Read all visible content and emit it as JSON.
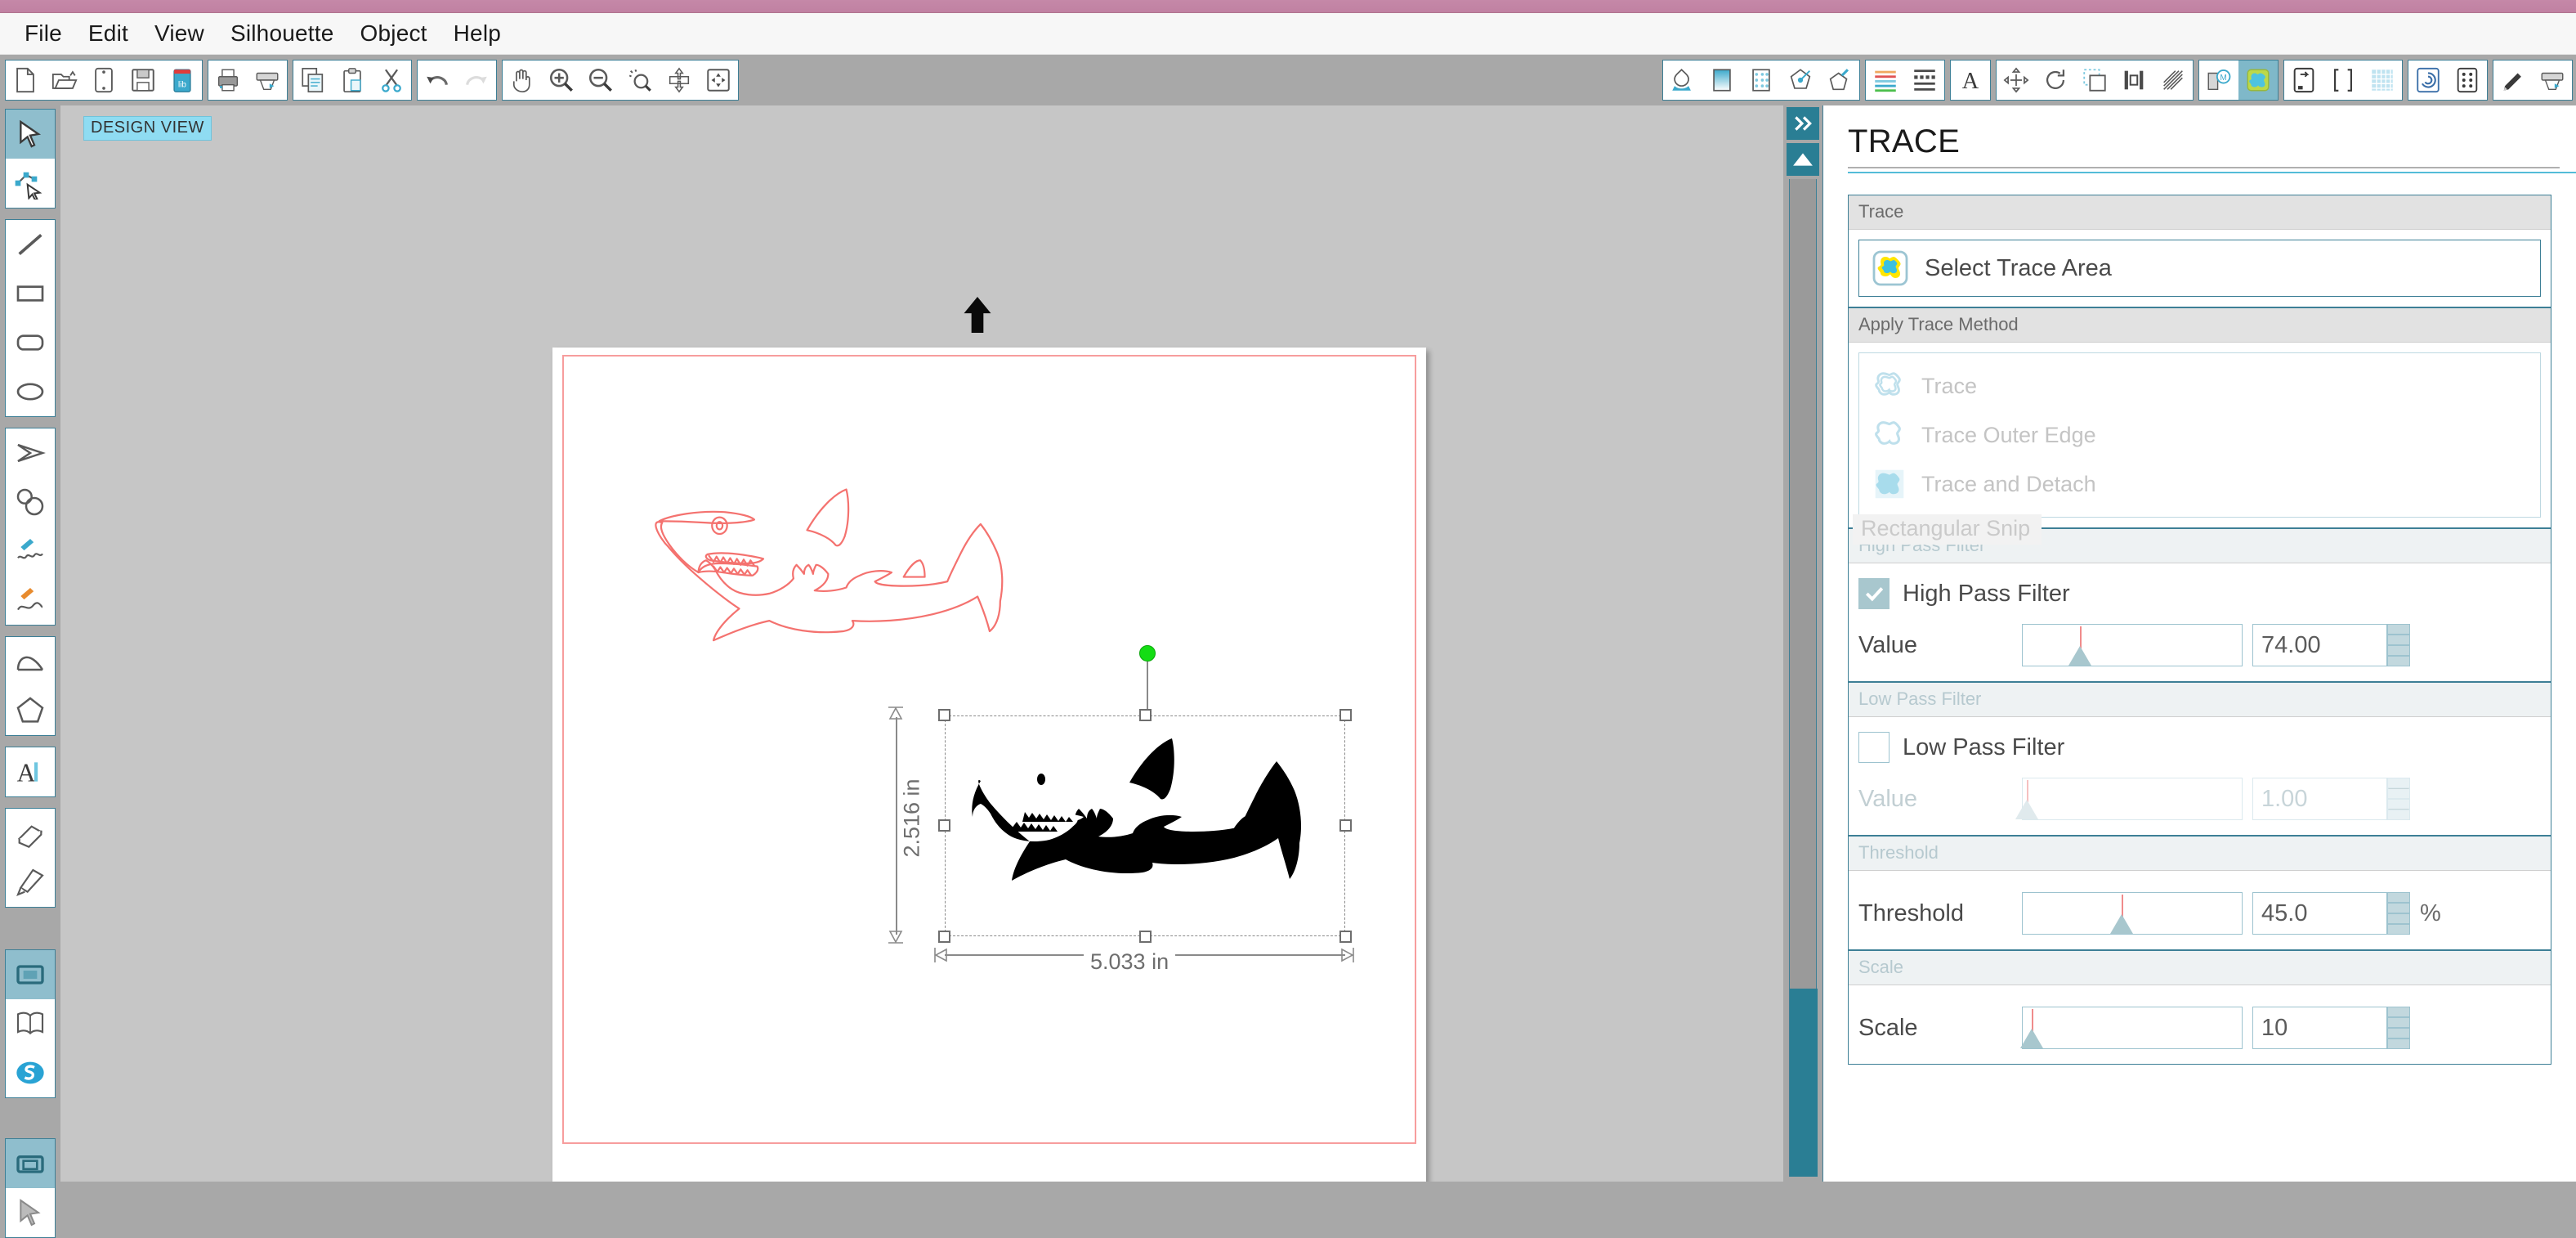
{
  "window": {
    "title_bar_color": "#c588a8"
  },
  "menubar": {
    "items": [
      {
        "label": "File"
      },
      {
        "label": "Edit"
      },
      {
        "label": "View"
      },
      {
        "label": "Silhouette"
      },
      {
        "label": "Object"
      },
      {
        "label": "Help"
      }
    ]
  },
  "toolbar": {
    "left_groups": [
      {
        "buttons": [
          {
            "name": "new-document-icon",
            "label": "New"
          },
          {
            "name": "open-document-icon",
            "label": "Open"
          },
          {
            "name": "save-as-icon",
            "label": "Save As"
          },
          {
            "name": "save-icon",
            "label": "Save"
          },
          {
            "name": "library-icon",
            "label": "Library"
          }
        ]
      },
      {
        "buttons": [
          {
            "name": "print-icon",
            "label": "Print"
          },
          {
            "name": "send-to-silhouette-icon",
            "label": "Send"
          }
        ]
      },
      {
        "buttons": [
          {
            "name": "copy-icon",
            "label": "Copy"
          },
          {
            "name": "paste-icon",
            "label": "Paste"
          },
          {
            "name": "cut-icon",
            "label": "Cut"
          }
        ]
      },
      {
        "buttons": [
          {
            "name": "undo-icon",
            "label": "Undo"
          },
          {
            "name": "redo-icon",
            "label": "Redo"
          }
        ]
      },
      {
        "buttons": [
          {
            "name": "pan-hand-icon",
            "label": "Pan"
          },
          {
            "name": "zoom-in-icon",
            "label": "Zoom In"
          },
          {
            "name": "zoom-out-icon",
            "label": "Zoom Out"
          },
          {
            "name": "zoom-selection-icon",
            "label": "Zoom to Selection"
          },
          {
            "name": "fit-to-page-icon",
            "label": "Fit to Page"
          },
          {
            "name": "fit-to-window-icon",
            "label": "Fit to Window"
          }
        ]
      }
    ],
    "right_groups": [
      {
        "buttons": [
          {
            "name": "fill-color-icon",
            "label": "Fill Color"
          },
          {
            "name": "gradient-fill-icon",
            "label": "Gradient Fill"
          },
          {
            "name": "pattern-fill-icon",
            "label": "Pattern Fill"
          },
          {
            "name": "line-color-icon",
            "label": "Line Color"
          },
          {
            "name": "sketch-pen-icon",
            "label": "Sketch Pen"
          }
        ]
      },
      {
        "buttons": [
          {
            "name": "line-style-icon",
            "label": "Line Style"
          },
          {
            "name": "stipple-icon",
            "label": "Stipple"
          }
        ]
      },
      {
        "buttons": [
          {
            "name": "text-style-icon",
            "label": "Text Style"
          }
        ]
      },
      {
        "buttons": [
          {
            "name": "transform-icon",
            "label": "Transform"
          },
          {
            "name": "replicate-icon",
            "label": "Replicate"
          },
          {
            "name": "offset-icon",
            "label": "Offset"
          },
          {
            "name": "align-icon",
            "label": "Align"
          },
          {
            "name": "modify-icon",
            "label": "Modify"
          }
        ]
      },
      {
        "buttons": [
          {
            "name": "pixscan-icon",
            "label": "PixScan"
          },
          {
            "name": "trace-icon",
            "label": "Trace",
            "active": true
          }
        ]
      },
      {
        "buttons": [
          {
            "name": "page-setup-icon",
            "label": "Page Setup"
          },
          {
            "name": "cutting-mat-icon",
            "label": "Cutting Mat"
          },
          {
            "name": "grid-icon",
            "label": "Grid"
          }
        ]
      },
      {
        "buttons": [
          {
            "name": "registration-marks-icon",
            "label": "Registration Marks"
          },
          {
            "name": "print-bleed-icon",
            "label": "Print Bleed"
          }
        ]
      },
      {
        "buttons": [
          {
            "name": "cut-settings-icon",
            "label": "Cut Settings"
          },
          {
            "name": "send-panel-icon",
            "label": "Send"
          }
        ]
      }
    ]
  },
  "left_palette": {
    "groups": [
      {
        "tools": [
          {
            "name": "select-tool",
            "label": "Select",
            "active": true
          },
          {
            "name": "edit-points-tool",
            "label": "Edit Points"
          }
        ]
      },
      {
        "tools": [
          {
            "name": "line-tool",
            "label": "Line"
          },
          {
            "name": "rectangle-tool",
            "label": "Rectangle"
          },
          {
            "name": "rounded-rectangle-tool",
            "label": "Rounded Rectangle"
          },
          {
            "name": "ellipse-tool",
            "label": "Ellipse"
          }
        ]
      },
      {
        "tools": [
          {
            "name": "polygon-tool",
            "label": "Polygon"
          },
          {
            "name": "curve-shape-tool",
            "label": "Curve Shape"
          },
          {
            "name": "draw-freehand-tool",
            "label": "Draw a Freehand Shape"
          },
          {
            "name": "draw-smooth-freehand-tool",
            "label": "Draw a Smooth Freehand Shape"
          }
        ]
      },
      {
        "tools": [
          {
            "name": "arc-tool",
            "label": "Arc"
          },
          {
            "name": "regular-polygon-tool",
            "label": "Regular Polygon"
          }
        ]
      },
      {
        "tools": [
          {
            "name": "text-tool",
            "label": "Text"
          }
        ]
      },
      {
        "tools": [
          {
            "name": "eraser-tool",
            "label": "Eraser"
          },
          {
            "name": "knife-tool",
            "label": "Knife"
          }
        ]
      },
      {
        "tools": [
          {
            "name": "design-page-tool",
            "label": "Design Page",
            "active": true
          },
          {
            "name": "library-tool",
            "label": "Library"
          },
          {
            "name": "store-tool",
            "label": "Silhouette Design Store"
          }
        ]
      },
      {
        "tools": [
          {
            "name": "send-page-tool",
            "label": "Send",
            "active": true
          }
        ]
      }
    ]
  },
  "canvas": {
    "view_badge": "DESIGN VIEW",
    "page_border_color": "#f79d9d",
    "traced_outline_color": "#f4726f",
    "selection": {
      "width_label": "5.033 in",
      "height_label": "2.516 in",
      "rotate_handle_color": "#14dd14"
    }
  },
  "trace_panel": {
    "title": "TRACE",
    "sections": {
      "trace": {
        "header": "Trace",
        "select_trace_area_label": "Select Trace Area"
      },
      "apply_trace_method": {
        "header": "Apply Trace Method",
        "methods": [
          {
            "name": "trace-method",
            "label": "Trace"
          },
          {
            "name": "trace-outer-edge-method",
            "label": "Trace Outer Edge"
          },
          {
            "name": "trace-and-detach-method",
            "label": "Trace and Detach"
          }
        ],
        "tooltip": "Rectangular Snip"
      },
      "high_pass_filter": {
        "header": "High Pass Filter",
        "checkbox_label": "High Pass Filter",
        "checked": true,
        "value_label": "Value",
        "value": "74.00",
        "slider_percent": 26
      },
      "low_pass_filter": {
        "header": "Low Pass Filter",
        "checkbox_label": "Low Pass Filter",
        "checked": false,
        "value_label": "Value",
        "value": "1.00",
        "slider_percent": 2
      },
      "threshold": {
        "header": "Threshold",
        "label": "Threshold",
        "value": "45.0",
        "unit": "%",
        "slider_percent": 45
      },
      "scale": {
        "header": "Scale",
        "label": "Scale",
        "value": "10",
        "slider_percent": 4
      }
    }
  }
}
